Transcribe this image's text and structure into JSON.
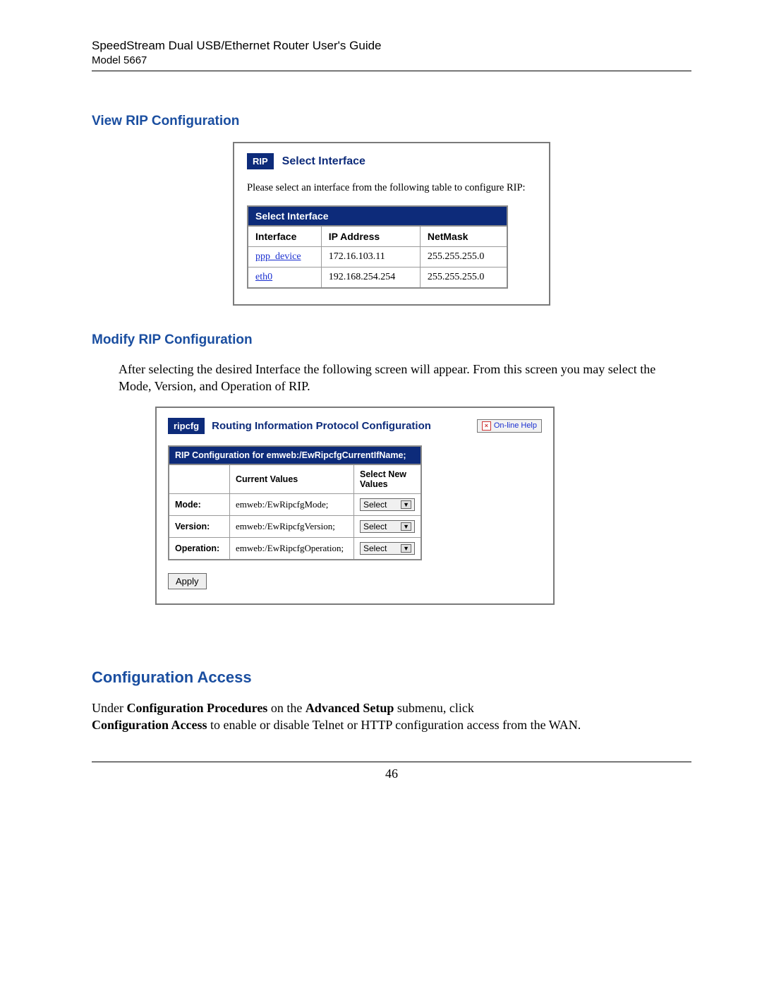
{
  "header": {
    "title": "SpeedStream Dual USB/Ethernet Router User's Guide",
    "model": "Model 5667"
  },
  "section1": {
    "title": "View RIP Configuration",
    "panel": {
      "chip": "RIP",
      "heading": "Select Interface",
      "instruction": "Please select an interface from the following table to configure RIP:",
      "table_caption": "Select Interface",
      "cols": {
        "c0": "Interface",
        "c1": "IP Address",
        "c2": "NetMask"
      },
      "rows": [
        {
          "iface": "ppp_device",
          "ip": "172.16.103.11",
          "mask": "255.255.255.0"
        },
        {
          "iface": "eth0",
          "ip": "192.168.254.254",
          "mask": "255.255.255.0"
        }
      ]
    }
  },
  "section2": {
    "title": "Modify RIP Configuration",
    "body": "After selecting the desired Interface the following screen will appear.  From this screen you may select the Mode, Version, and Operation of RIP.",
    "panel": {
      "chip": "ripcfg",
      "heading": "Routing Information Protocol Configuration",
      "help": "On-line Help",
      "caption": "RIP Configuration for emweb:/EwRipcfgCurrentIfName;",
      "head": {
        "h0": "",
        "h1": "Current Values",
        "h2": "Select New Values"
      },
      "rows": [
        {
          "label": "Mode:",
          "val": "emweb:/EwRipcfgMode;",
          "sel": "Select"
        },
        {
          "label": "Version:",
          "val": "emweb:/EwRipcfgVersion;",
          "sel": "Select"
        },
        {
          "label": "Operation:",
          "val": "emweb:/EwRipcfgOperation;",
          "sel": "Select"
        }
      ],
      "apply": "Apply"
    }
  },
  "section3": {
    "title": "Configuration Access",
    "body_pre": "Under ",
    "body_b1": "Configuration Procedures",
    "body_mid1": " on the ",
    "body_b2": "Advanced Setup",
    "body_mid2": " submenu, click ",
    "body_b3": "Configuration Access",
    "body_post": " to enable or disable Telnet or HTTP configuration access from the WAN."
  },
  "page_number": "46"
}
